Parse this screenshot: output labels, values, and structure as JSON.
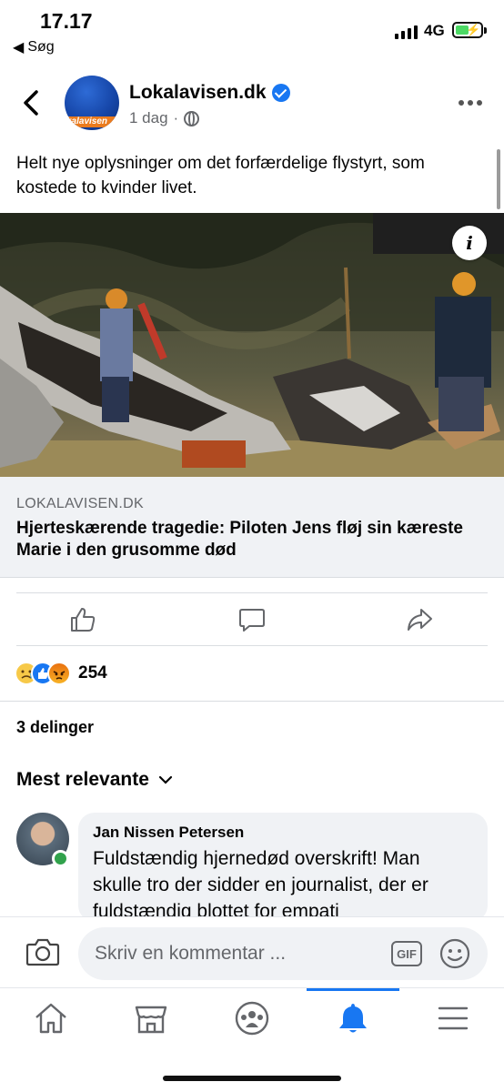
{
  "status_bar": {
    "time": "17.17",
    "back_app": "Søg",
    "network": "4G"
  },
  "post": {
    "page_name": "Lokalavisen.dk",
    "avatar_brand": "kalavisen",
    "time": "1 dag",
    "separator": "·",
    "text": "Helt nye oplysninger om det forfærdelige flystyrt, som kostede to kvinder livet.",
    "link": {
      "domain": "LOKALAVISEN.DK",
      "title": "Hjerteskærende tragedie: Piloten Jens fløj sin kæreste Marie i den grusomme død"
    },
    "reactions": {
      "types": [
        "sad",
        "like",
        "angry"
      ],
      "count": "254"
    },
    "shares": "3 delinger",
    "sort_label": "Mest relevante"
  },
  "comment": {
    "author": "Jan Nissen Petersen",
    "text": "Fuldstændig hjernedød overskrift! Man skulle tro der sidder en journalist, der er fuldstændig blottet for empati"
  },
  "composer": {
    "placeholder": "Skriv en kommentar ...",
    "gif_label": "GIF"
  },
  "tabs": [
    {
      "icon": "home-icon",
      "active": false
    },
    {
      "icon": "marketplace-icon",
      "active": false
    },
    {
      "icon": "groups-icon",
      "active": false
    },
    {
      "icon": "bell-icon",
      "active": true
    },
    {
      "icon": "menu-icon",
      "active": false
    }
  ],
  "colors": {
    "accent": "#1877f2",
    "secondary_text": "#65676b",
    "card_bg": "#f0f2f5",
    "online": "#31a24c"
  }
}
